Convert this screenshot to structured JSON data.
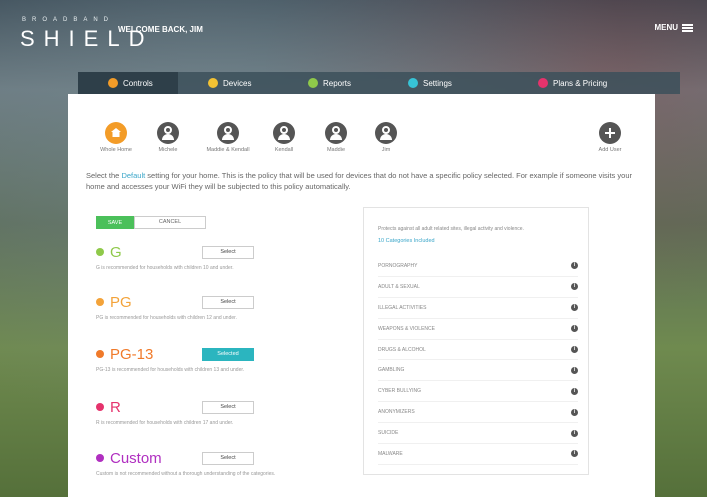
{
  "header": {
    "brand_small": "BROADBAND",
    "brand_big": "SHIELD",
    "welcome": "WELCOME BACK, JIM",
    "menu_label": "MENU"
  },
  "tabs": [
    {
      "label": "Controls",
      "color": "#f39c28"
    },
    {
      "label": "Devices",
      "color": "#f3c233"
    },
    {
      "label": "Reports",
      "color": "#8fc94a"
    },
    {
      "label": "Settings",
      "color": "#37c3d6"
    },
    {
      "label": "Plans & Pricing",
      "color": "#e5336c"
    }
  ],
  "profiles": [
    {
      "label": "Whole Home"
    },
    {
      "label": "Michele"
    },
    {
      "label": "Maddie & Kendall"
    },
    {
      "label": "Kendall"
    },
    {
      "label": "Maddie"
    },
    {
      "label": "Jim"
    },
    {
      "label": "Add User"
    }
  ],
  "intro": {
    "before": "Select the ",
    "highlight": "Default",
    "after": " setting for your home. This is the policy that will be used for devices that do not have a specific policy selected. For example if someone visits your home and accesses your WiFi they will be subjected to this policy automatically."
  },
  "actions": {
    "save": "SAVE",
    "cancel": "CANCEL"
  },
  "ratings": [
    {
      "name": "G",
      "color": "#8fc94a",
      "button": "Select",
      "selected": false,
      "desc": "G is recommended for households with children 10 and under."
    },
    {
      "name": "PG",
      "color": "#f3a33a",
      "button": "Select",
      "selected": false,
      "desc": "PG is recommended for households with children 12 and under."
    },
    {
      "name": "PG-13",
      "color": "#f07a2a",
      "button": "Selected",
      "selected": true,
      "desc": "PG-13 is recommended for households with children 13 and under."
    },
    {
      "name": "R",
      "color": "#e5336c",
      "button": "Select",
      "selected": false,
      "desc": "R is recommended for households with children 17 and under."
    },
    {
      "name": "Custom",
      "color": "#b02fc0",
      "button": "Select",
      "selected": false,
      "desc": "Custom is not recommended without a thorough understanding of the categories."
    }
  ],
  "categories": {
    "heading": "Protects against all adult related sites, illegal activity and violence.",
    "count_label": "10 Categories Included",
    "info_glyph": "i",
    "items": [
      "PORNOGRAPHY",
      "ADULT & SEXUAL",
      "ILLEGAL ACTIVITIES",
      "WEAPONS & VIOLENCE",
      "DRUGS & ALCOHOL",
      "GAMBLING",
      "CYBER BULLYING",
      "ANONYMIZERS",
      "SUICIDE",
      "MALWARE"
    ]
  }
}
